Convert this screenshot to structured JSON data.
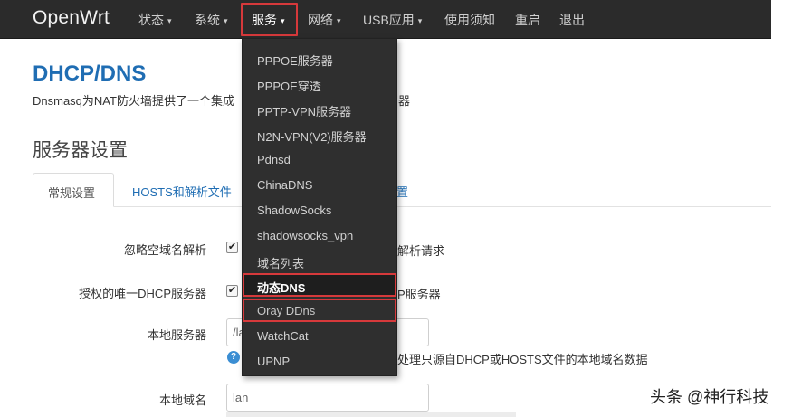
{
  "navbar": {
    "brand": "OpenWrt",
    "items": [
      {
        "label": "状态",
        "caret": "▾"
      },
      {
        "label": "系统",
        "caret": "▾"
      },
      {
        "label": "服务",
        "caret": "▾"
      },
      {
        "label": "网络",
        "caret": "▾"
      },
      {
        "label": "USB应用",
        "caret": "▾"
      },
      {
        "label": "使用须知",
        "caret": ""
      },
      {
        "label": "重启",
        "caret": ""
      },
      {
        "label": "退出",
        "caret": ""
      }
    ],
    "active_item": "服务"
  },
  "page": {
    "title": "DHCP/DNS",
    "description": "Dnsmasq为NAT防火墙提供了一个集成",
    "description_tail": "器",
    "section_title": "服务器设置"
  },
  "tabs": [
    {
      "label": "常规设置"
    },
    {
      "label": "HOSTS和解析文件"
    },
    {
      "label": "置"
    }
  ],
  "form": {
    "rows": [
      {
        "label": "忽略空域名解析",
        "checked": "✔",
        "tail": "解析请求"
      },
      {
        "label": "授权的唯一DHCP服务器",
        "checked": "✔",
        "tail": "P服务器"
      },
      {
        "label": "本地服务器",
        "value": "/la",
        "help": "?",
        "help_text": "处理只源自DHCP或HOSTS文件的本地域名数据"
      },
      {
        "label": "本地域名",
        "value": "lan"
      }
    ]
  },
  "dropdown": {
    "items": [
      {
        "label": "PPPOE服务器"
      },
      {
        "label": "PPPOE穿透"
      },
      {
        "label": "PPTP-VPN服务器"
      },
      {
        "label": "N2N-VPN(V2)服务器"
      },
      {
        "label": "Pdnsd"
      },
      {
        "label": "ChinaDNS"
      },
      {
        "label": "ShadowSocks"
      },
      {
        "label": "shadowsocks_vpn"
      },
      {
        "label": "域名列表"
      },
      {
        "label": "动态DNS"
      },
      {
        "label": "Oray DDns"
      },
      {
        "label": "WatchCat"
      },
      {
        "label": "UPNP"
      }
    ]
  },
  "watermark": "头条 @神行科技",
  "colors": {
    "navbar_bg": "#2b2b2b",
    "link_blue": "#1f6db3",
    "highlight_red": "#d6393b"
  }
}
